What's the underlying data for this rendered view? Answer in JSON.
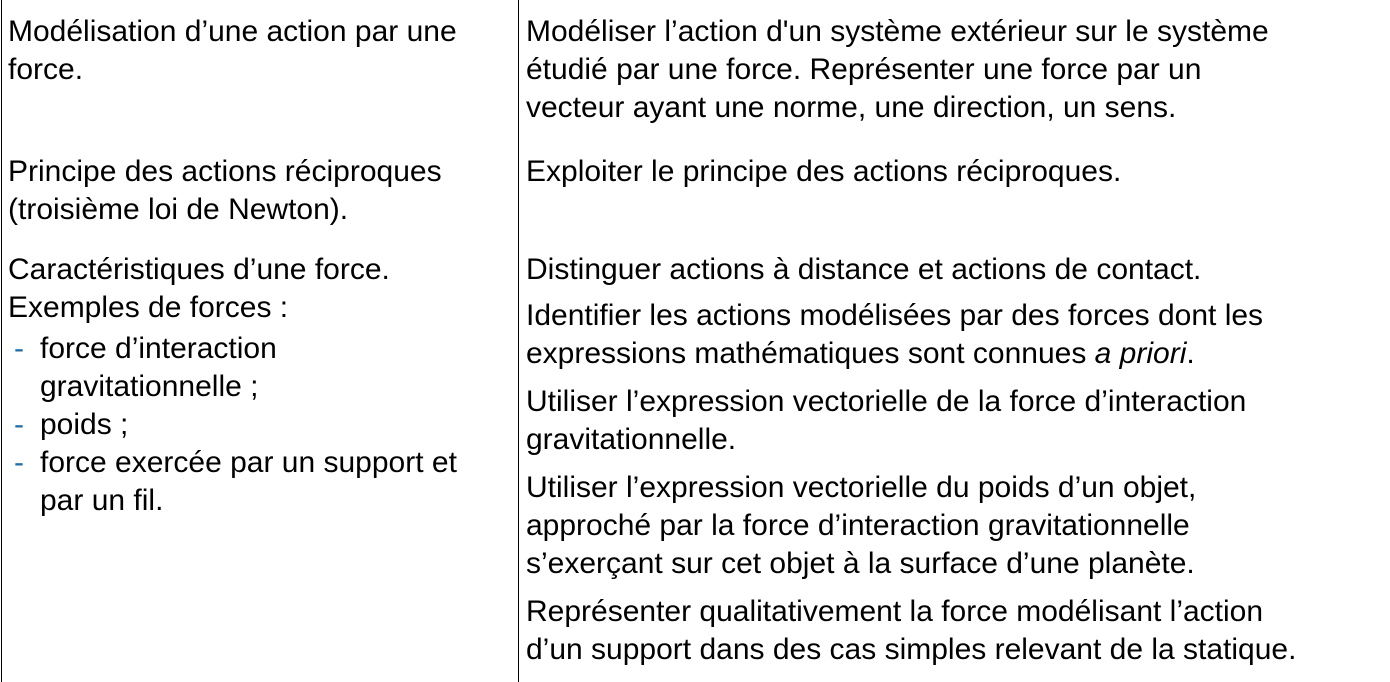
{
  "rows": [
    {
      "left": {
        "lines": [
          "Modélisation d’une action par une",
          "force."
        ]
      },
      "right": {
        "lines": [
          "Modéliser l’action d'un système extérieur sur le système",
          "étudié par une force. Représenter une force par un",
          "vecteur ayant une norme, une direction, un sens."
        ]
      }
    },
    {
      "left": {
        "lines": [
          "Principe des actions réciproques",
          "(troisième loi de Newton)."
        ]
      },
      "right": {
        "lines": [
          "Exploiter le principe des actions réciproques."
        ]
      }
    },
    {
      "left": {
        "lines": [
          "Caractéristiques d’une force.",
          "Exemples de forces :"
        ],
        "bullet_marker": "-",
        "bullets": [
          [
            "force d’interaction",
            "gravitationnelle ;"
          ],
          [
            "poids ;"
          ],
          [
            "force exercée par un support et",
            "par un fil."
          ]
        ]
      },
      "right": {
        "paragraphs": [
          [
            "Distinguer actions à distance et actions de contact."
          ],
          [
            "Identifier les actions modélisées par des forces dont les",
            "expressions mathématiques sont connues "
          ],
          [
            "Utiliser l’expression vectorielle de la force d’interaction",
            "gravitationnelle."
          ],
          [
            "Utiliser l’expression vectorielle du poids d’un objet,",
            "approché par la force d’interaction gravitationnelle",
            "s’exerçant sur cet objet à la surface d’une planète."
          ],
          [
            "Représenter qualitativement la force modélisant l’action",
            "d’un support dans des cas simples relevant de la statique."
          ]
        ],
        "italic_tail": "a priori",
        "italic_tail_end": "."
      }
    }
  ],
  "colors": {
    "text": "#000000",
    "bullet": "#1f6fa8",
    "border": "#000000"
  }
}
